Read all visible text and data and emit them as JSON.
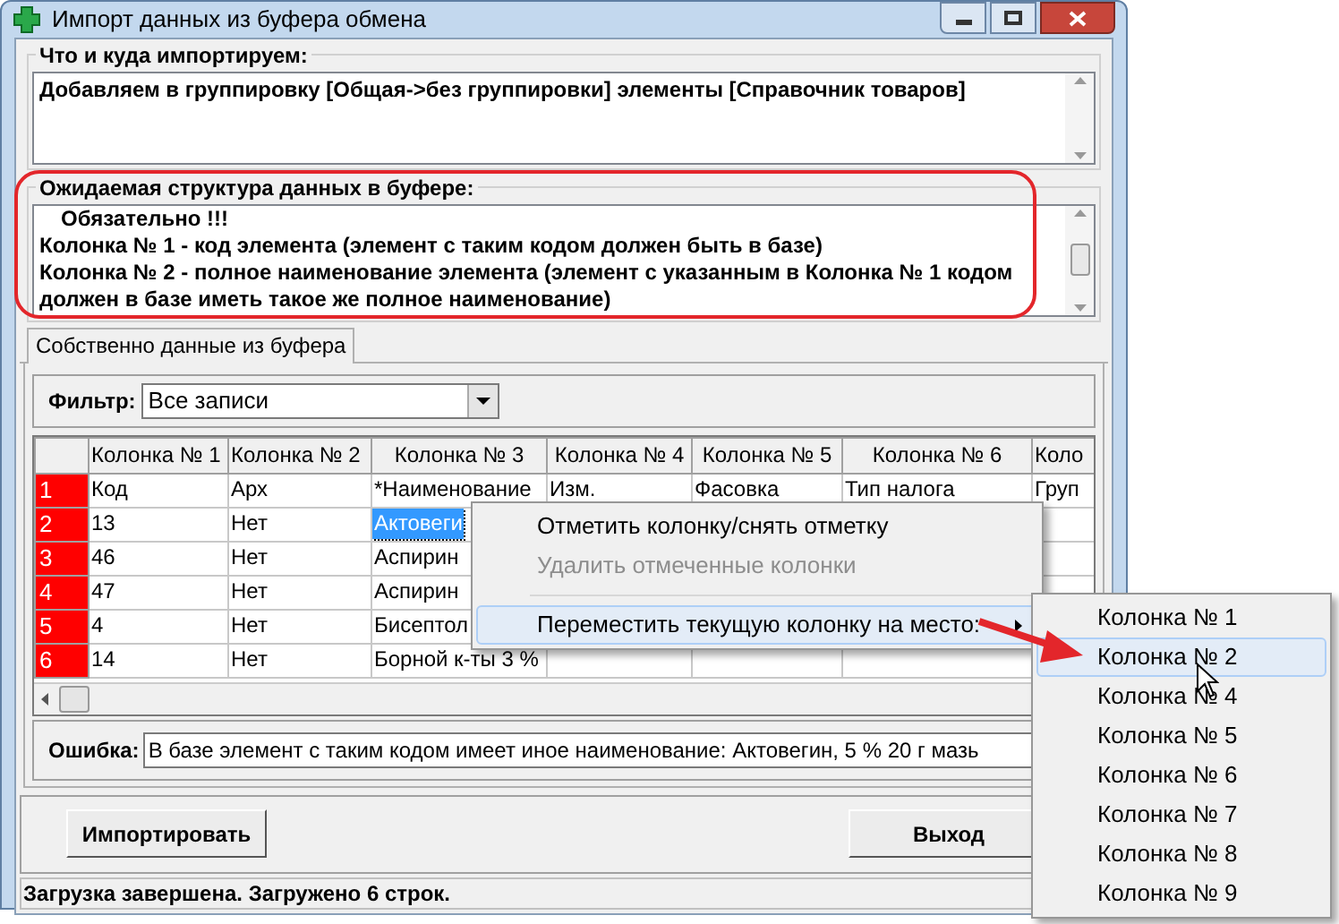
{
  "window": {
    "title": "Импорт данных из буфера обмена"
  },
  "target_group": {
    "label": "Что и куда импортируем:",
    "text": "Добавляем в группировку [Общая->без группировки] элементы [Справочник товаров]"
  },
  "structure_group": {
    "label": "Ожидаемая структура данных в буфере:",
    "heading": "Обязательно !!!",
    "lines": [
      "Колонка № 1 - код элемента (элемент с таким кодом должен быть в базе)",
      "Колонка № 2 - полное наименование элемента (элемент с указанным в Колонка № 1 кодом должен в базе иметь такое же полное наименование)"
    ]
  },
  "tabs": [
    {
      "label": "Собственно данные из буфера",
      "selected": true
    }
  ],
  "filter": {
    "label": "Фильтр:",
    "value": "Все записи"
  },
  "table": {
    "columns": [
      "Колонка № 1",
      "Колонка № 2",
      "Колонка № 3",
      "Колонка № 4",
      "Колонка № 5",
      "Колонка № 6",
      "Коло"
    ],
    "rows": [
      {
        "number": "1",
        "cells": [
          {
            "text": "Код",
            "selected": false
          },
          {
            "text": "Арх",
            "selected": false
          },
          {
            "text": "*Наименование",
            "selected": false
          },
          {
            "text": "Изм.",
            "selected": false
          },
          {
            "text": "Фасовка",
            "selected": false
          },
          {
            "text": "Тип налога",
            "selected": false
          },
          {
            "text": "Груп",
            "selected": false
          }
        ]
      },
      {
        "number": "2",
        "cells": [
          {
            "text": "13",
            "selected": false
          },
          {
            "text": "Нет",
            "selected": false
          },
          {
            "text": "Актовеги",
            "selected": true
          }
        ]
      },
      {
        "number": "3",
        "cells": [
          {
            "text": "46",
            "selected": false
          },
          {
            "text": "Нет",
            "selected": false
          },
          {
            "text": "Аспирин",
            "selected": false
          }
        ]
      },
      {
        "number": "4",
        "cells": [
          {
            "text": "47",
            "selected": false
          },
          {
            "text": "Нет",
            "selected": false
          },
          {
            "text": "Аспирин",
            "selected": false
          }
        ]
      },
      {
        "number": "5",
        "cells": [
          {
            "text": "4",
            "selected": false
          },
          {
            "text": "Нет",
            "selected": false
          },
          {
            "text": "Бисептол",
            "selected": false
          }
        ]
      },
      {
        "number": "6",
        "cells": [
          {
            "text": "14",
            "selected": false
          },
          {
            "text": "Нет",
            "selected": false
          },
          {
            "text": "Борной к-ты 3 %",
            "selected": false
          }
        ]
      }
    ]
  },
  "error": {
    "label": "Ошибка:",
    "value": "В базе элемент с таким кодом имеет иное наименование: Актовегин, 5 % 20 г мазь"
  },
  "buttons": [
    "Импортировать",
    "Выход"
  ],
  "status_bar": "Загрузка завершена. Загружено 6 строк.",
  "context_menu": {
    "items": [
      {
        "kind": "item",
        "label": "Отметить колонку/снять отметку",
        "disabled": false,
        "selected": false,
        "submenu": false
      },
      {
        "kind": "item",
        "label": "Удалить отмеченные колонки",
        "disabled": true,
        "selected": false,
        "submenu": false
      },
      {
        "kind": "separator"
      },
      {
        "kind": "item",
        "label": "Переместить текущую колонку на место:",
        "disabled": false,
        "selected": true,
        "submenu": true
      }
    ]
  },
  "submenu": {
    "items": [
      {
        "label": "Колонка № 1",
        "selected": false
      },
      {
        "label": "Колонка № 2",
        "selected": true
      },
      {
        "label": "Колонка № 4",
        "selected": false
      },
      {
        "label": "Колонка № 5",
        "selected": false
      },
      {
        "label": "Колонка № 6",
        "selected": false
      },
      {
        "label": "Колонка № 7",
        "selected": false
      },
      {
        "label": "Колонка № 8",
        "selected": false
      },
      {
        "label": "Колонка № 9",
        "selected": false
      }
    ]
  }
}
